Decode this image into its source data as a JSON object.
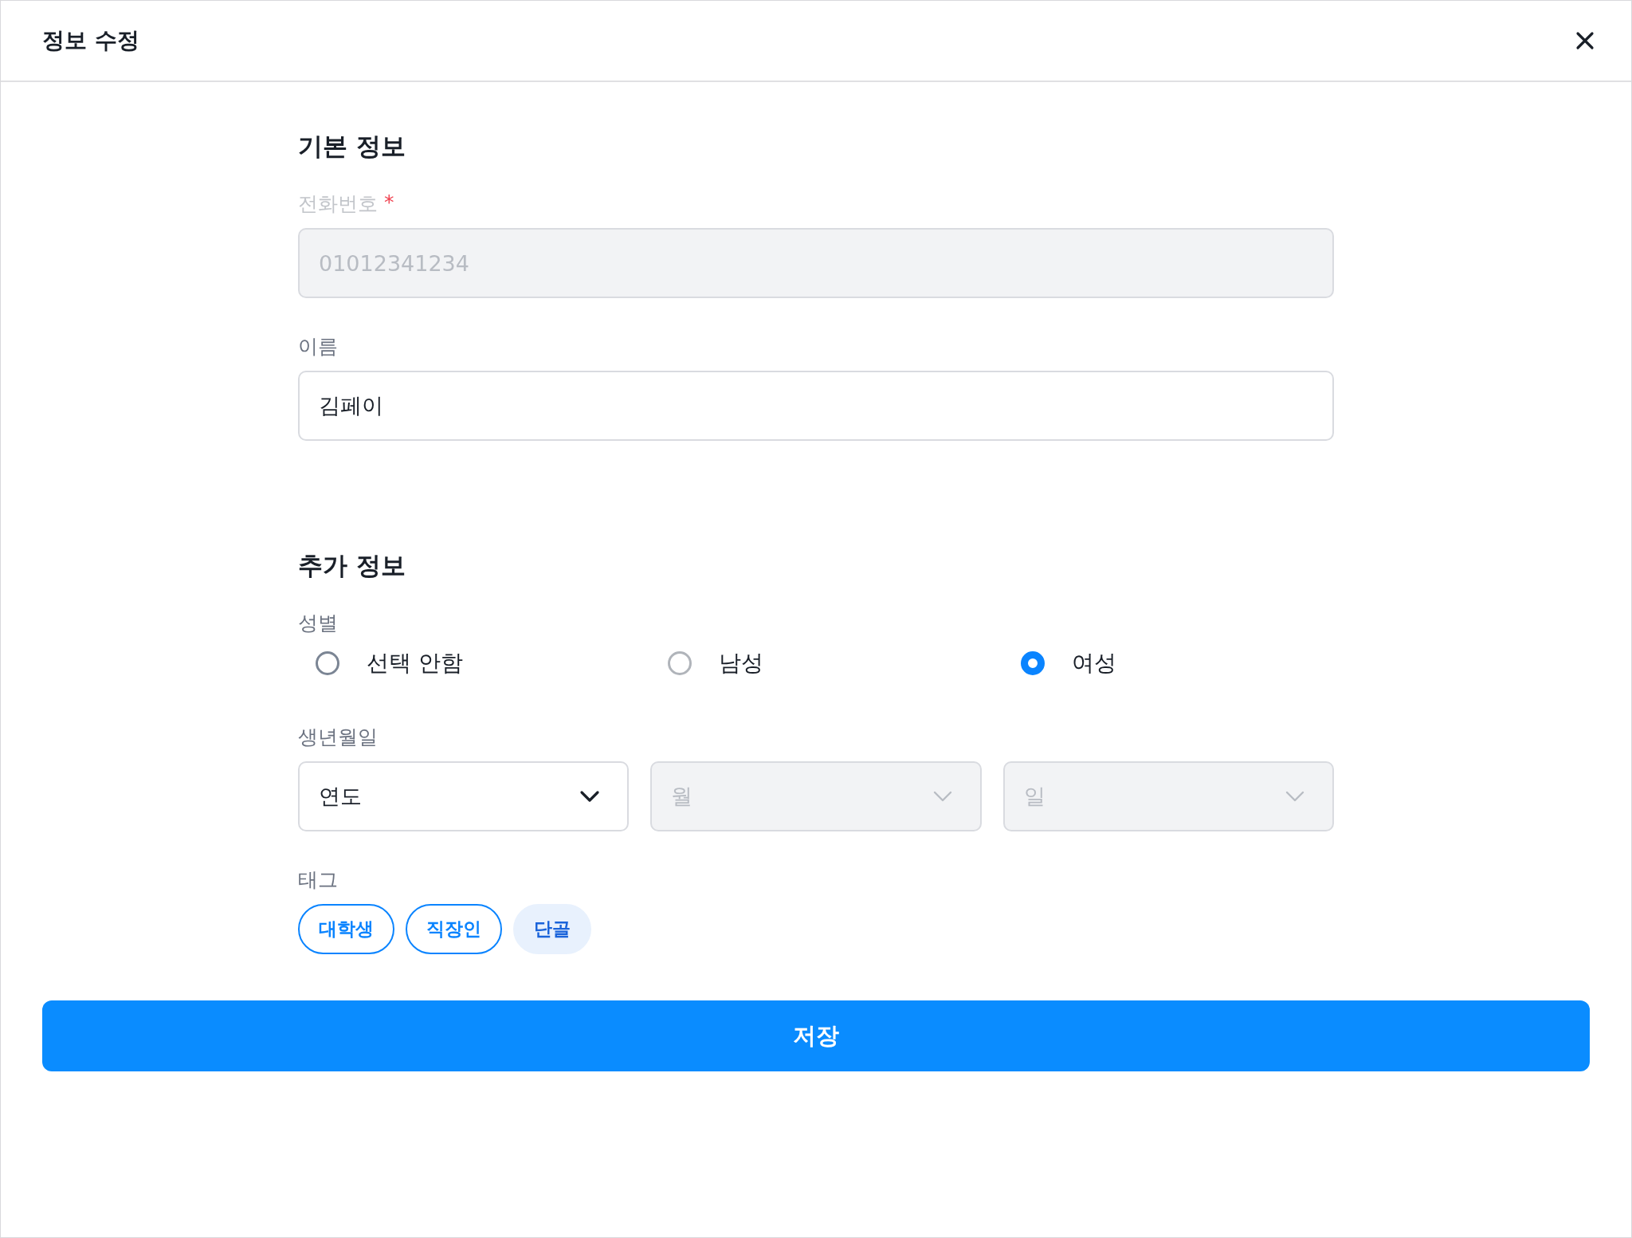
{
  "header": {
    "title": "정보 수정"
  },
  "basic": {
    "title": "기본 정보",
    "phone": {
      "label": "전화번호",
      "required_mark": "*",
      "value": "01012341234",
      "disabled": true
    },
    "name": {
      "label": "이름",
      "value": "김페이",
      "disabled": false
    }
  },
  "extra": {
    "title": "추가 정보",
    "gender": {
      "label": "성별",
      "options": [
        {
          "label": "선택 안함",
          "selected": false
        },
        {
          "label": "남성",
          "selected": false
        },
        {
          "label": "여성",
          "selected": true
        }
      ]
    },
    "birth": {
      "label": "생년월일",
      "selects": [
        {
          "placeholder": "연도",
          "disabled": false
        },
        {
          "placeholder": "월",
          "disabled": true
        },
        {
          "placeholder": "일",
          "disabled": true
        }
      ]
    },
    "tags": {
      "label": "태그",
      "items": [
        {
          "label": "대학생",
          "selected": true
        },
        {
          "label": "직장인",
          "selected": true
        },
        {
          "label": "단골",
          "selected": false
        }
      ]
    }
  },
  "save_button": "저장"
}
